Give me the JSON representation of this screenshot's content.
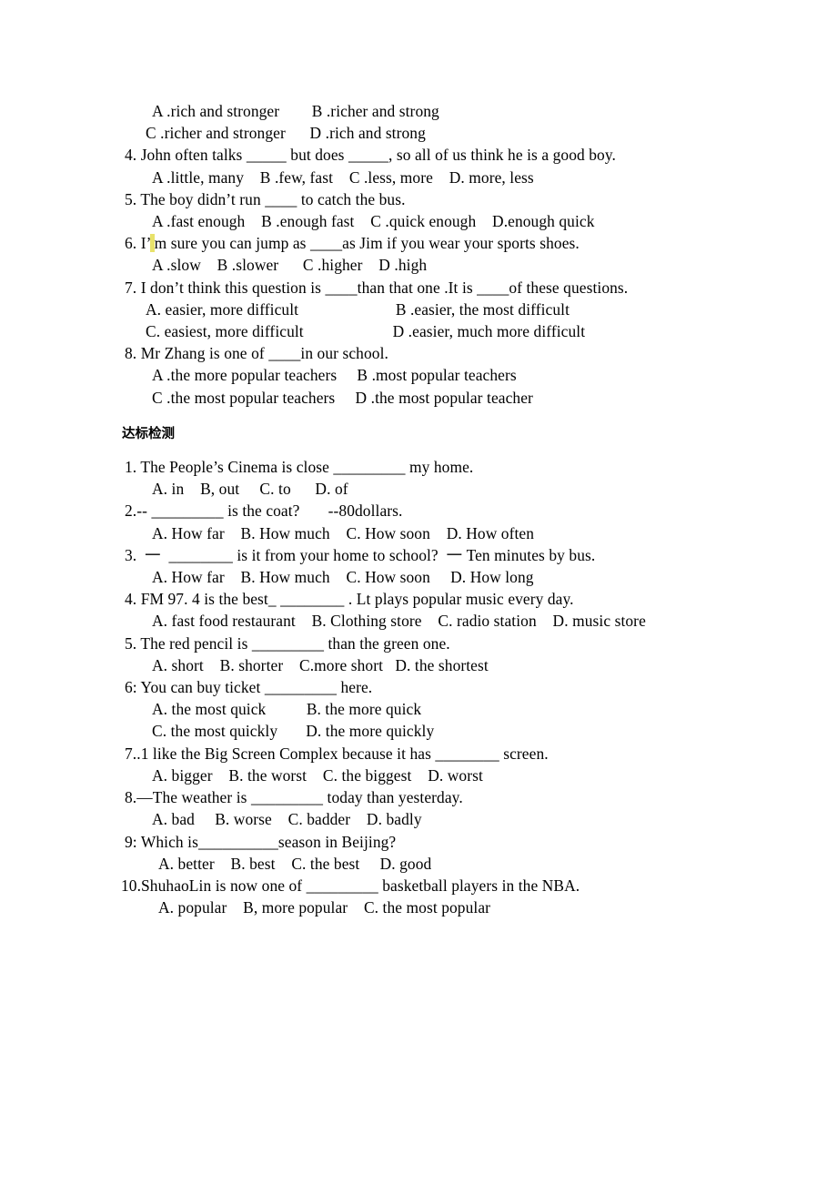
{
  "document": {
    "type": "english-grammar-worksheet",
    "background_color": "#ffffff",
    "text_color": "#000000"
  },
  "section_one": {
    "lines": [
      {
        "id": "q3-options-ab",
        "text": "A .rich and stronger        B .richer and strong"
      },
      {
        "id": "q3-options-cd",
        "text": "C .richer and stronger      D .rich and strong"
      },
      {
        "id": "q4-stem",
        "text": "4. John often talks _____ but does _____, so all of us think he is a good boy."
      },
      {
        "id": "q4-options",
        "text": "A .little, many    B .few, fast    C .less, more    D. more, less"
      },
      {
        "id": "q5-stem",
        "text": "5. The boy didn’t run ____ to catch the bus."
      },
      {
        "id": "q5-options",
        "text": "A .fast enough    B .enough fast    C .quick enough    D.enough quick"
      },
      {
        "id": "q6-stem-a",
        "text": "6. I’"
      },
      {
        "id": "q6-stem-b",
        "text": "m sure you can jump as ____as Jim if you wear your sports shoes."
      },
      {
        "id": "q6-options",
        "text": "A .slow    B .slower      C .higher    D .high"
      },
      {
        "id": "q7-stem",
        "text": "7. I don’t think this question is ____than that one .It is ____of these questions."
      },
      {
        "id": "q7-options-a",
        "text": "A. easier, more difficult                        B .easier, the most difficult"
      },
      {
        "id": "q7-options-c",
        "text": "C. easiest, more difficult                      D .easier, much more difficult"
      },
      {
        "id": "q8-stem",
        "text": "8. Mr Zhang is one of ____in our school."
      },
      {
        "id": "q8-options-ab",
        "text": "A .the more popular teachers     B .most popular teachers"
      },
      {
        "id": "q8-options-cd",
        "text": "C .the most popular teachers     D .the most popular teacher"
      }
    ]
  },
  "section_two": {
    "heading": "达标检测",
    "lines": [
      {
        "id": "q1-stem",
        "text": "1. The People’s Cinema is close _________ my home."
      },
      {
        "id": "q1-options",
        "text": "A. in    B, out     C. to      D. of"
      },
      {
        "id": "q2-stem",
        "text": "2.-- _________ is the coat?       --80dollars."
      },
      {
        "id": "q2-options",
        "text": "A. How far    B. How much    C. How soon    D. How often"
      },
      {
        "id": "q3-stem",
        "text": "3.  一  ________ is it from your home to school?  一 Ten minutes by bus."
      },
      {
        "id": "q3-options",
        "text": "A. How far    B. How much    C. How soon     D. How long"
      },
      {
        "id": "q4-stem",
        "text": "4. FM 97. 4 is the best_ ________ . Lt plays popular music every day."
      },
      {
        "id": "q4-options",
        "text": "A. fast food restaurant    B. Clothing store    C. radio station    D. music store"
      },
      {
        "id": "q5-stem",
        "text": "5. The red pencil is _________ than the green one."
      },
      {
        "id": "q5-options",
        "text": "A. short    B. shorter    C.more short   D. the shortest"
      },
      {
        "id": "q6-stem",
        "text": "6: You can buy ticket _________ here."
      },
      {
        "id": "q6-options-ab",
        "text": "A. the most quick          B. the more quick"
      },
      {
        "id": "q6-options-cd",
        "text": "C. the most quickly       D. the more quickly"
      },
      {
        "id": "q7-stem",
        "text": "7..1 like the Big Screen Complex because it has ________ screen."
      },
      {
        "id": "q7-options",
        "text": "A. bigger    B. the worst    C. the biggest    D. worst"
      },
      {
        "id": "q8-stem",
        "text": "8.—The weather is _________ today than yesterday."
      },
      {
        "id": "q8-options",
        "text": "A. bad     B. worse    C. badder    D. badly"
      },
      {
        "id": "q9-stem",
        "text": "9: Which is__________season in Beijing?"
      },
      {
        "id": "q9-options",
        "text": "A. better    B. best    C. the best     D. good"
      },
      {
        "id": "q10-stem",
        "text": "10.ShuhaoLin is now one of _________ basketball players in the NBA."
      },
      {
        "id": "q10-options",
        "text": "A. popular    B, more popular    C. the most popular"
      }
    ]
  }
}
